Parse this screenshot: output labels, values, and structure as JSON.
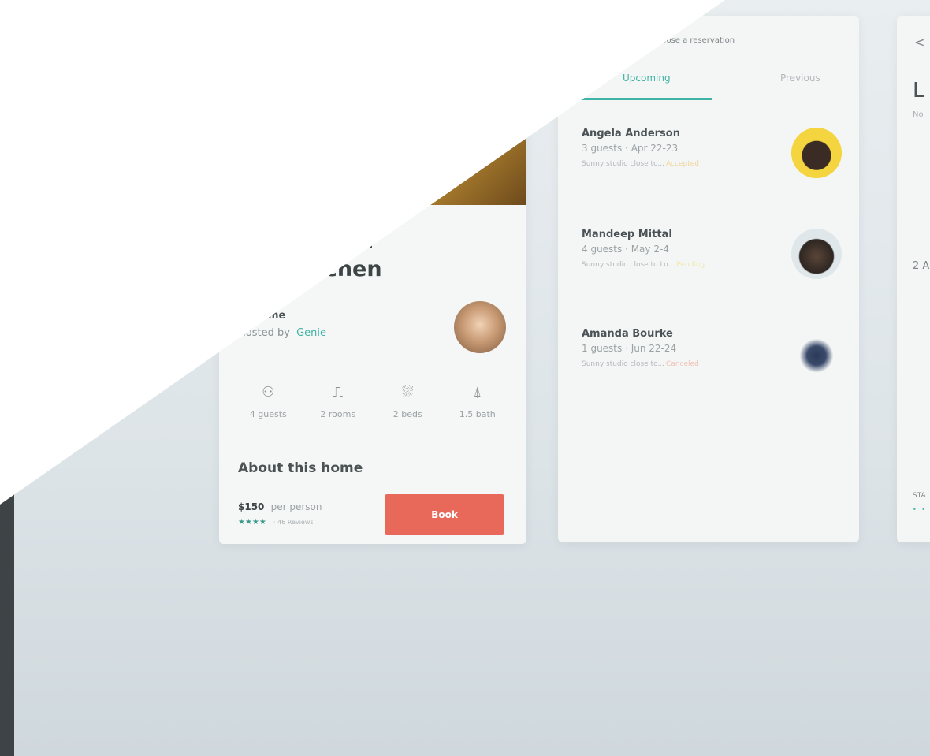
{
  "listing": {
    "title": "Open Floor Plan and Kitchen",
    "title_visible": "pen Floor\nd Kitchen",
    "type": "re home",
    "hosted_by": "Hosted by",
    "host": "Genie",
    "amenities": [
      {
        "icon": "guests-icon",
        "label": "4 guests"
      },
      {
        "icon": "rooms-icon",
        "label": "2 rooms"
      },
      {
        "icon": "beds-icon",
        "label": "2 beds"
      },
      {
        "icon": "bath-icon",
        "label": "1.5 bath"
      }
    ],
    "about": "About this home",
    "price": "$150",
    "per": "per person",
    "stars": "★★★★",
    "reviews": "· 46 Reviews",
    "book": "Book"
  },
  "reservations": {
    "header": "Choose a reservation",
    "tabs": {
      "upcoming": "Upcoming",
      "previous": "Previous"
    },
    "items": [
      {
        "name": "Angela Anderson",
        "meta": "3 guests · Apr 22-23",
        "sub": "Sunny studio close to...",
        "status": "Accepted",
        "status_color": "#f0d59a"
      },
      {
        "name": "Mandeep Mittal",
        "meta": "4 guests · May 2-4",
        "sub": "Sunny studio close to Lo...",
        "status": "Pending",
        "status_color": "#f1e9a8"
      },
      {
        "name": "Amanda Bourke",
        "meta": "1 guests · Jun 22-24",
        "sub": "Sunny studio close to...",
        "status": "Canceled",
        "status_color": "#f2c1b6"
      }
    ]
  },
  "right_panel": {
    "back": "<",
    "big": "L",
    "small": "No",
    "count": "2 A",
    "bottom": "STA",
    "dots": "• • •"
  },
  "colors": {
    "accent": "#3fb3a4",
    "book": "#e8695a"
  }
}
